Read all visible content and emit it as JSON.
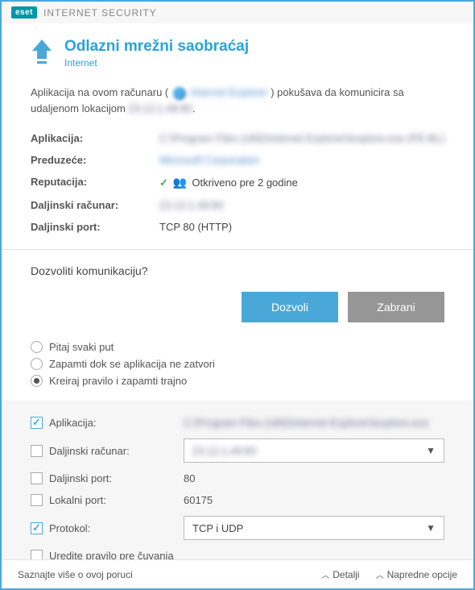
{
  "titlebar": {
    "brand": "eset",
    "product": "INTERNET SECURITY"
  },
  "header": {
    "title": "Odlazni mrežni saobraćaj",
    "subtitle": "Internet"
  },
  "intro": {
    "prefix": "Aplikacija na ovom računaru (",
    "app_blur": "Internet Explorer",
    "mid": ") pokušava da komunicira sa udaljenom lokacijom ",
    "loc_blur": "23.12.1.48:80"
  },
  "info": {
    "app_label": "Aplikacija:",
    "app_value_blur": "C:\\Program Files (x86)\\Internet Explorer\\iexplore.exe (PE‑BL)",
    "publisher_label": "Preduzeće:",
    "publisher_value_blur": "Microsoft Corporation",
    "reputation_label": "Reputacija:",
    "reputation_text": "Otkriveno pre 2 godine",
    "remote_label": "Daljinski računar:",
    "remote_value_blur": "23.12.1.48:80",
    "port_label": "Daljinski port:",
    "port_value": "TCP 80 (HTTP)"
  },
  "question": "Dozvoliti komunikaciju?",
  "buttons": {
    "allow": "Dozvoli",
    "deny": "Zabrani"
  },
  "radios": {
    "ask": "Pitaj svaki put",
    "remember_until_close": "Zapamti dok se aplikacija ne zatvori",
    "create_rule": "Kreiraj pravilo i zapamti trajno"
  },
  "rule": {
    "app_label": "Aplikacija:",
    "app_value_blur": "C:\\Program Files (x86)\\Internet Explorer\\iexplore.exe",
    "remote_label": "Daljinski računar:",
    "remote_value_blur": "23.12.1.48:80",
    "remote_port_label": "Daljinski port:",
    "remote_port_value": "80",
    "local_port_label": "Lokalni port:",
    "local_port_value": "60175",
    "protocol_label": "Protokol:",
    "protocol_value": "TCP i UDP",
    "edit_label": "Uredite pravilo pre čuvanja"
  },
  "footer": {
    "learn_more": "Saznajte više o ovoj poruci",
    "details": "Detalji",
    "advanced": "Napredne opcije"
  }
}
